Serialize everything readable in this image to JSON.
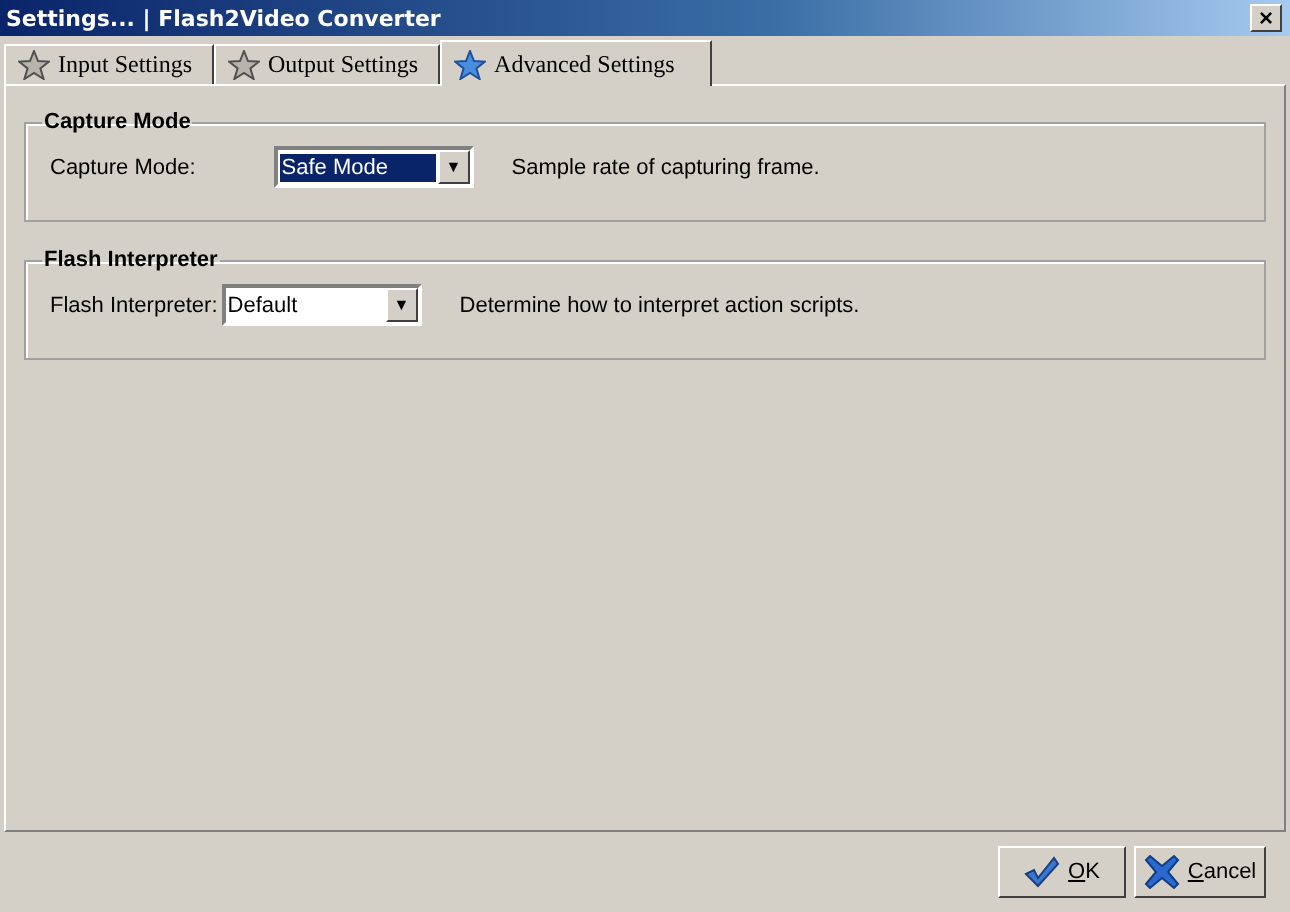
{
  "window": {
    "title": "Settings... | Flash2Video Converter",
    "close": "×"
  },
  "tabs": [
    {
      "label": "Input Settings",
      "selected": false
    },
    {
      "label": "Output Settings",
      "selected": false
    },
    {
      "label": "Advanced Settings",
      "selected": true
    }
  ],
  "groups": [
    {
      "title": "Capture Mode",
      "label": "Capture Mode:",
      "value": "Safe Mode",
      "focused": true,
      "arrow": "▼",
      "description": "Sample rate of capturing frame."
    },
    {
      "title": "Flash Interpreter",
      "label": "Flash Interpreter:",
      "value": "Default",
      "focused": false,
      "arrow": "▼",
      "description": "Determine how to interpret action scripts."
    }
  ],
  "buttons": [
    {
      "kind": "ok",
      "label": "OK"
    },
    {
      "kind": "cancel",
      "label": "Cancel"
    }
  ]
}
